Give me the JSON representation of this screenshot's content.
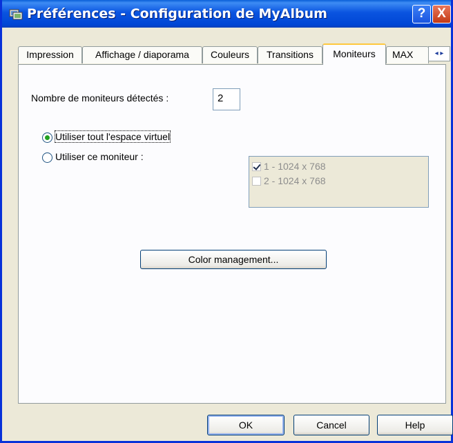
{
  "window": {
    "title": "Préférences - Configuration de MyAlbum",
    "help_label": "?",
    "close_label": "X"
  },
  "tabs": [
    {
      "label": "Impression",
      "active": false
    },
    {
      "label": "Affichage / diaporama",
      "active": false
    },
    {
      "label": "Couleurs",
      "active": false
    },
    {
      "label": "Transitions",
      "active": false
    },
    {
      "label": "Moniteurs",
      "active": true
    },
    {
      "label": "MAX",
      "active": false
    }
  ],
  "tab_scroll": {
    "left": "◂",
    "right": "▸"
  },
  "monitors": {
    "detected_label": "Nombre de moniteurs détectés :",
    "detected_count": "2",
    "option_virtual": {
      "label": "Utiliser tout l'espace virtuel",
      "selected": true
    },
    "option_single": {
      "label": "Utiliser ce moniteur :",
      "selected": false
    },
    "list": [
      {
        "label": "1 - 1024 x 768",
        "checked": true
      },
      {
        "label": "2 - 1024 x 768",
        "checked": false
      }
    ],
    "color_management_label": "Color management..."
  },
  "buttons": {
    "ok": "OK",
    "cancel": "Cancel",
    "help": "Help"
  },
  "colors": {
    "titlebar": "#0054e3",
    "dialog_bg": "#ece9d8",
    "tab_highlight": "#ffc83c",
    "radio_dot": "#21a121"
  }
}
